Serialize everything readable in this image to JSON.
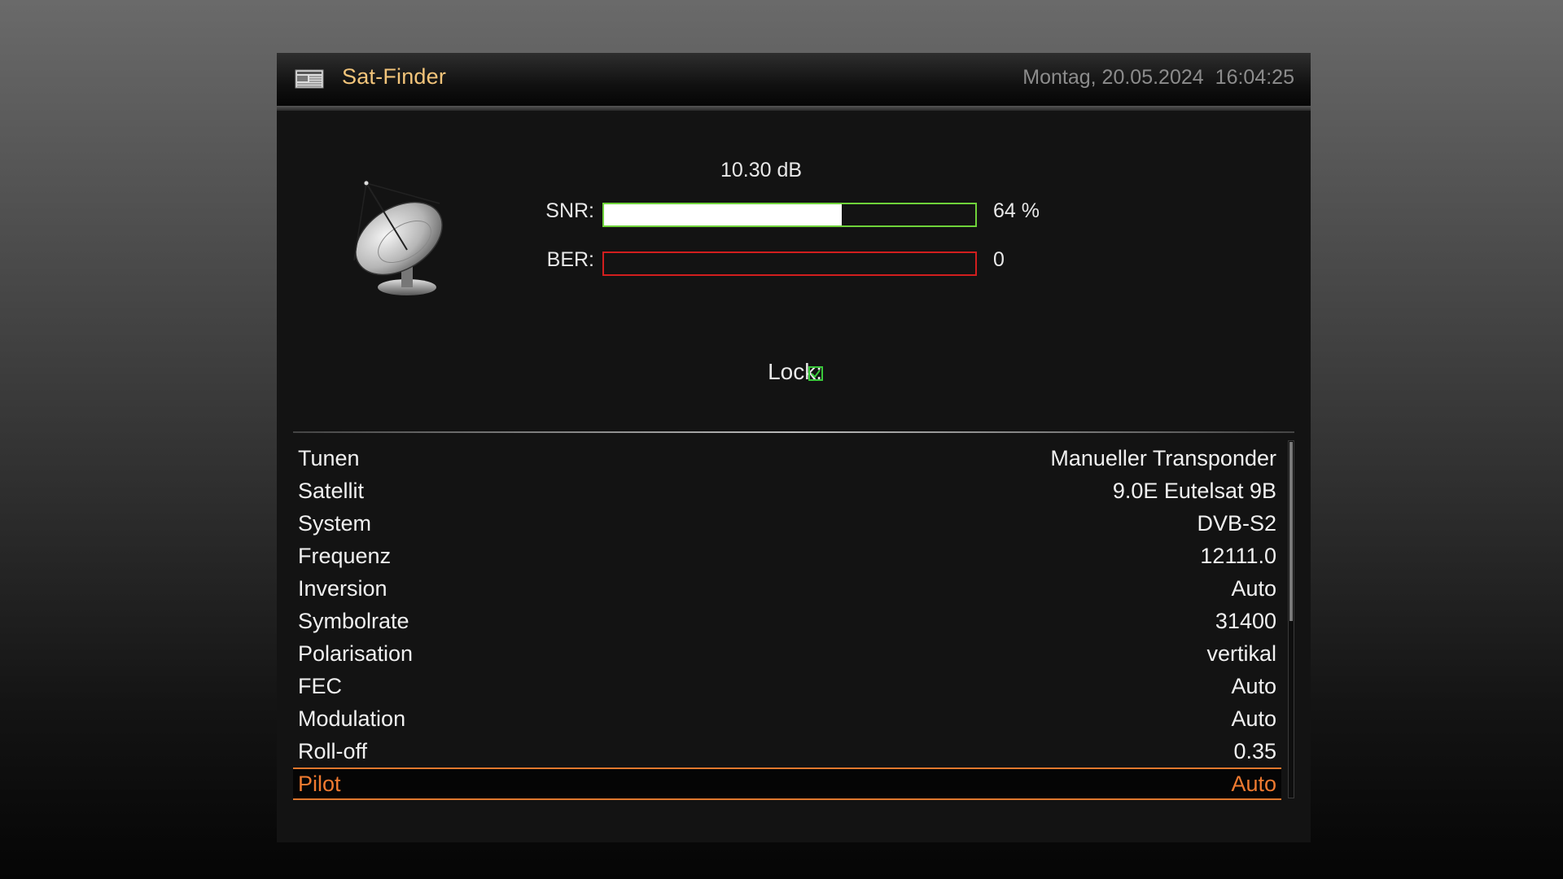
{
  "header": {
    "title": "Sat-Finder",
    "date": "Montag, 20.05.2024",
    "time": "16:04:25",
    "icon": "newspaper-icon"
  },
  "signal": {
    "db_value": "10.30 dB",
    "snr_label": "SNR:",
    "snr_value": "64 %",
    "snr_fraction": 0.64,
    "ber_label": "BER:",
    "ber_value": "0",
    "ber_fraction": 0,
    "lock_label": "Lock:",
    "locked": true
  },
  "settings": [
    {
      "label": "Tunen",
      "value": "Manueller Transponder"
    },
    {
      "label": "Satellit",
      "value": "9.0E Eutelsat 9B"
    },
    {
      "label": "System",
      "value": "DVB-S2"
    },
    {
      "label": "Frequenz",
      "value": "12111.0"
    },
    {
      "label": "Inversion",
      "value": "Auto"
    },
    {
      "label": "Symbolrate",
      "value": "31400"
    },
    {
      "label": "Polarisation",
      "value": "vertikal"
    },
    {
      "label": "FEC",
      "value": "Auto"
    },
    {
      "label": "Modulation",
      "value": "Auto"
    },
    {
      "label": "Roll-off",
      "value": "0.35"
    },
    {
      "label": "Pilot",
      "value": "Auto"
    }
  ],
  "selected_index": 10,
  "colors": {
    "title": "#f2c47a",
    "snr_border": "#6fd23a",
    "ber_border": "#d21e1e",
    "selection": "#e0782e",
    "lock": "#39c83a"
  }
}
